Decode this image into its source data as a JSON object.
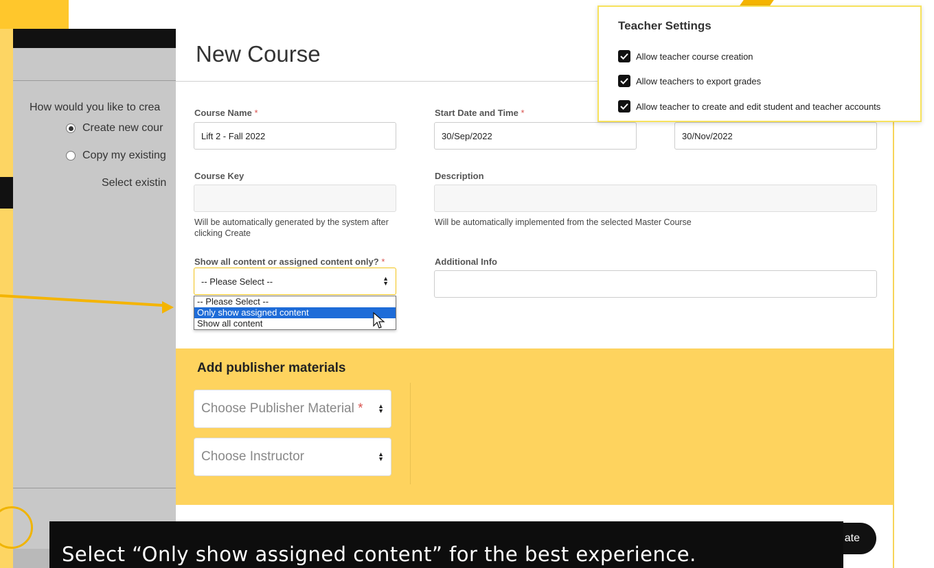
{
  "background": {
    "question": "How would you like to crea",
    "options": [
      "Create new cour",
      "Copy my existing"
    ],
    "select_existing": "Select existin"
  },
  "modal": {
    "title": "New Course",
    "fields": {
      "course_name": {
        "label": "Course Name",
        "required": "*",
        "value": "Lift 2 - Fall 2022"
      },
      "start_date": {
        "label": "Start Date and Time",
        "required": "*",
        "value": "30/Sep/2022"
      },
      "end_date": {
        "value": "30/Nov/2022"
      },
      "course_key": {
        "label": "Course Key",
        "value": "",
        "help": "Will be automatically generated by the system after clicking Create"
      },
      "description": {
        "label": "Description",
        "value": "",
        "help": "Will be automatically implemented from the selected Master Course"
      },
      "show_content": {
        "label": "Show all content or assigned content only?",
        "required": "*",
        "value": "-- Please Select --",
        "options": [
          "-- Please Select --",
          "Only show assigned content",
          "Show all content"
        ],
        "highlighted_index": 1
      },
      "additional_info": {
        "label": "Additional Info",
        "value": ""
      }
    },
    "publisher": {
      "title": "Add publisher materials",
      "material_placeholder": "Choose Publisher Material",
      "material_required": "*",
      "instructor_placeholder": "Choose Instructor"
    },
    "create_label": "ate"
  },
  "teacher_settings": {
    "title": "Teacher Settings",
    "items": [
      {
        "label": "Allow teacher course creation",
        "checked": true
      },
      {
        "label": "Allow teachers to export grades",
        "checked": true
      },
      {
        "label": "Allow teacher to create and edit student and teacher accounts",
        "checked": true
      }
    ]
  },
  "caption": "Select “Only show assigned content” for the best experience.",
  "colors": {
    "accent_yellow": "#fed35e",
    "highlight_blue": "#1e6cd8",
    "required_red": "#d9534f"
  }
}
